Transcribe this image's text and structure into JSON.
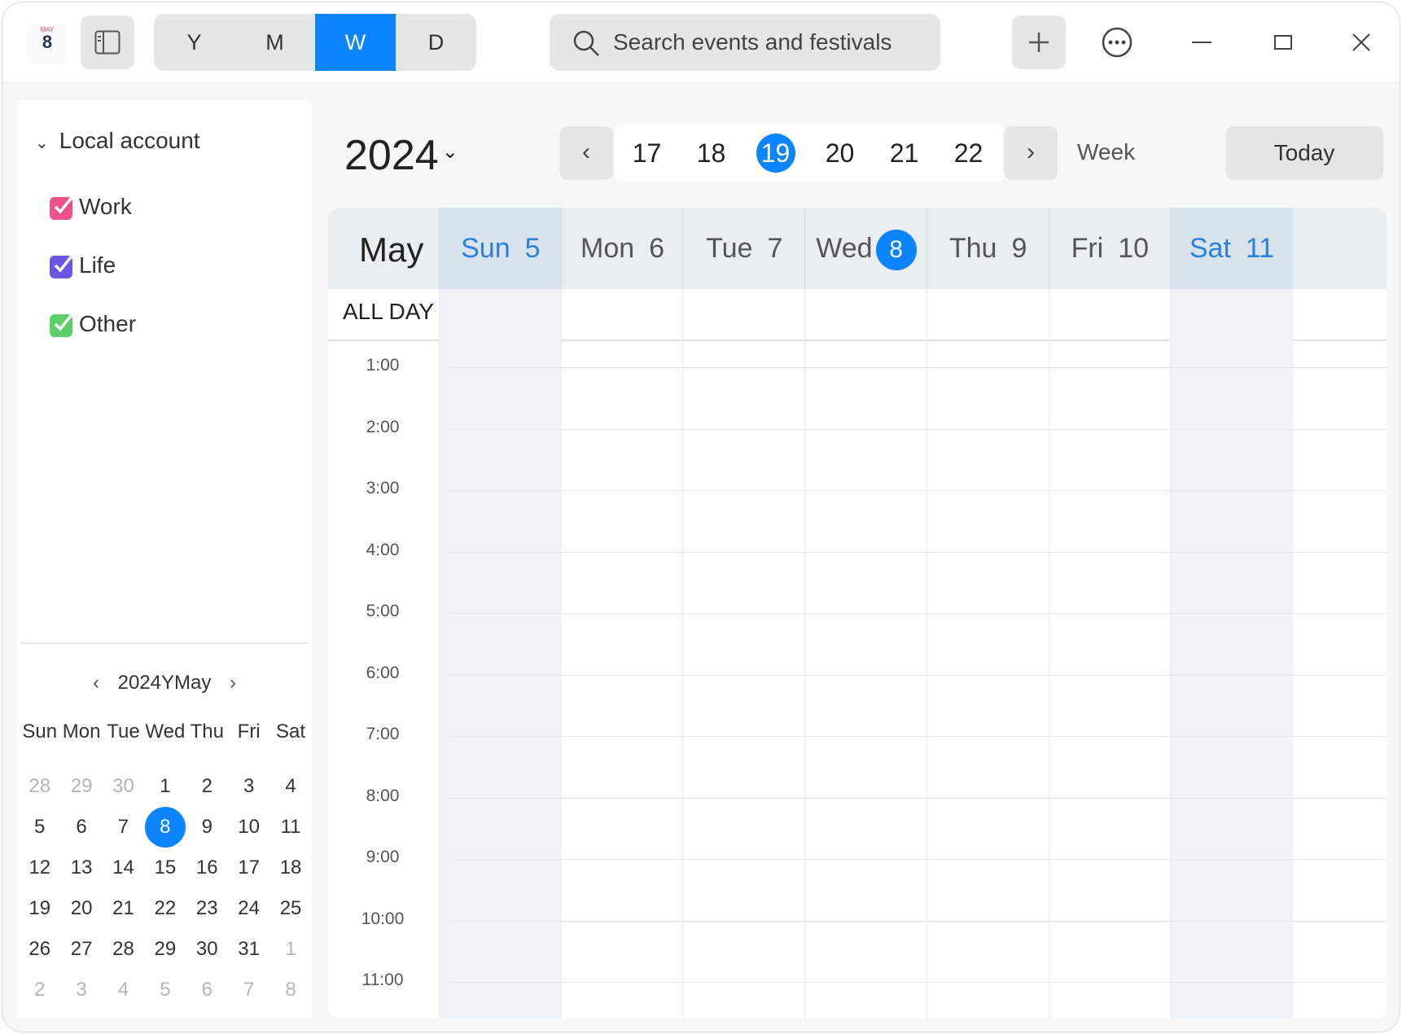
{
  "app": {
    "icon_month": "MAY",
    "icon_day": "8"
  },
  "toolbar": {
    "views": [
      {
        "label": "Y",
        "active": false
      },
      {
        "label": "M",
        "active": false
      },
      {
        "label": "W",
        "active": true
      },
      {
        "label": "D",
        "active": false
      }
    ],
    "search_placeholder": "Search events and festivals"
  },
  "sidebar": {
    "account": "Local account",
    "calendars": [
      {
        "label": "Work",
        "color": "#f0508c"
      },
      {
        "label": "Life",
        "color": "#6a55e6"
      },
      {
        "label": "Other",
        "color": "#5ccf6b"
      }
    ],
    "mini_calendar": {
      "title": "2024YMay",
      "weekdays": [
        "Sun",
        "Mon",
        "Tue",
        "Wed",
        "Thu",
        "Fri",
        "Sat"
      ],
      "days": [
        {
          "d": "28",
          "out": true
        },
        {
          "d": "29",
          "out": true
        },
        {
          "d": "30",
          "out": true
        },
        {
          "d": "1"
        },
        {
          "d": "2"
        },
        {
          "d": "3"
        },
        {
          "d": "4"
        },
        {
          "d": "5"
        },
        {
          "d": "6"
        },
        {
          "d": "7"
        },
        {
          "d": "8",
          "today": true
        },
        {
          "d": "9"
        },
        {
          "d": "10"
        },
        {
          "d": "11"
        },
        {
          "d": "12"
        },
        {
          "d": "13"
        },
        {
          "d": "14"
        },
        {
          "d": "15"
        },
        {
          "d": "16"
        },
        {
          "d": "17"
        },
        {
          "d": "18"
        },
        {
          "d": "19"
        },
        {
          "d": "20"
        },
        {
          "d": "21"
        },
        {
          "d": "22"
        },
        {
          "d": "23"
        },
        {
          "d": "24"
        },
        {
          "d": "25"
        },
        {
          "d": "26"
        },
        {
          "d": "27"
        },
        {
          "d": "28"
        },
        {
          "d": "29"
        },
        {
          "d": "30"
        },
        {
          "d": "31"
        },
        {
          "d": "1",
          "out": true
        },
        {
          "d": "2",
          "out": true
        },
        {
          "d": "3",
          "out": true
        },
        {
          "d": "4",
          "out": true
        },
        {
          "d": "5",
          "out": true
        },
        {
          "d": "6",
          "out": true
        },
        {
          "d": "7",
          "out": true
        },
        {
          "d": "8",
          "out": true
        }
      ]
    }
  },
  "main": {
    "year": "2024",
    "weeks": [
      "17",
      "18",
      "19",
      "20",
      "21",
      "22"
    ],
    "current_week": "19",
    "week_label": "Week",
    "today_label": "Today",
    "month_label": "May",
    "allday_label": "ALL DAY",
    "days": [
      {
        "name": "Sun",
        "num": "5",
        "weekend": true
      },
      {
        "name": "Mon",
        "num": "6"
      },
      {
        "name": "Tue",
        "num": "7"
      },
      {
        "name": "Wed",
        "num": "8",
        "today": true
      },
      {
        "name": "Thu",
        "num": "9"
      },
      {
        "name": "Fri",
        "num": "10"
      },
      {
        "name": "Sat",
        "num": "11",
        "weekend": true
      }
    ],
    "hours": [
      "1:00",
      "2:00",
      "3:00",
      "4:00",
      "5:00",
      "6:00",
      "7:00",
      "8:00",
      "9:00",
      "10:00",
      "11:00"
    ]
  },
  "colors": {
    "accent": "#0a84ff",
    "weekend_text": "#2a7fe0"
  }
}
